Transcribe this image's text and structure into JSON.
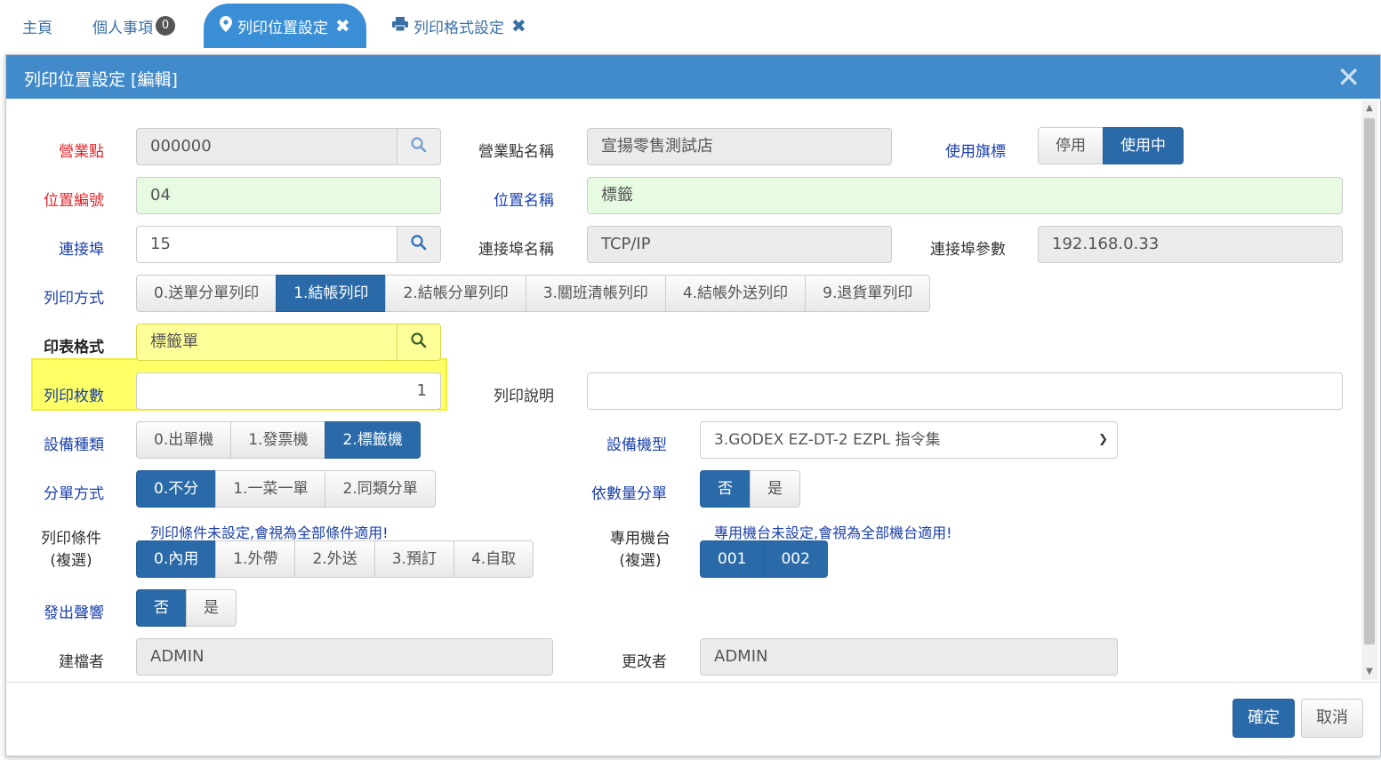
{
  "tabs": [
    {
      "label": "主頁"
    },
    {
      "label": "個人事項",
      "badge": "0"
    },
    {
      "label": "列印位置設定",
      "close": "✖"
    },
    {
      "label": "列印格式設定",
      "close": "✖"
    }
  ],
  "modal": {
    "title": "列印位置設定 [編輯]",
    "close": "✕"
  },
  "form": {
    "store": {
      "label": "營業點",
      "value": "000000"
    },
    "store_name": {
      "label": "營業點名稱",
      "value": "宣揚零售測試店"
    },
    "active_flag": {
      "label": "使用旗標",
      "options": [
        "停用",
        "使用中"
      ],
      "selected": "使用中"
    },
    "position_no": {
      "label": "位置編號",
      "value": "04"
    },
    "position_name": {
      "label": "位置名稱",
      "value": "標籤"
    },
    "port": {
      "label": "連接埠",
      "value": "15"
    },
    "port_name": {
      "label": "連接埠名稱",
      "value": "TCP/IP"
    },
    "port_param": {
      "label": "連接埠參數",
      "value": "192.168.0.33"
    },
    "print_mode": {
      "label": "列印方式",
      "options": [
        "0.送單分單列印",
        "1.結帳列印",
        "2.結帳分單列印",
        "3.關班清帳列印",
        "4.結帳外送列印",
        "9.退貨單列印"
      ],
      "selected": "1.結帳列印"
    },
    "print_format": {
      "label": "印表格式",
      "value": "標籤單"
    },
    "copies": {
      "label": "列印枚數",
      "value": "1"
    },
    "print_desc": {
      "label": "列印說明",
      "value": ""
    },
    "device_type": {
      "label": "設備種類",
      "options": [
        "0.出單機",
        "1.發票機",
        "2.標籤機"
      ],
      "selected": "2.標籤機"
    },
    "device_model": {
      "label": "設備機型",
      "value": "3.GODEX EZ-DT-2 EZPL 指令集"
    },
    "split_mode": {
      "label": "分單方式",
      "options": [
        "0.不分",
        "1.一菜一單",
        "2.同類分單"
      ],
      "selected": "0.不分"
    },
    "split_by_qty": {
      "label": "依數量分單",
      "options": [
        "否",
        "是"
      ],
      "selected": "否"
    },
    "print_condition": {
      "label1": "列印條件",
      "label2": "(複選)",
      "hint": "列印條件未設定,會視為全部條件適用!",
      "options": [
        "0.內用",
        "1.外帶",
        "2.外送",
        "3.預訂",
        "4.自取"
      ],
      "selected": [
        "0.內用"
      ]
    },
    "dedicated_machine": {
      "label1": "專用機台",
      "label2": "(複選)",
      "hint": "專用機台未設定,會視為全部機台適用!",
      "options": [
        "001",
        "002"
      ],
      "selected": [
        "001",
        "002"
      ]
    },
    "beep": {
      "label": "發出聲響",
      "options": [
        "否",
        "是"
      ],
      "selected": "否"
    },
    "creator": {
      "label": "建檔者",
      "value": "ADMIN"
    },
    "modifier": {
      "label": "更改者",
      "value": "ADMIN"
    }
  },
  "footer": {
    "confirm": "確定",
    "cancel": "取消"
  },
  "colors": {
    "header": "#428bca",
    "primary_button": "#2b6aa8",
    "highlight": "#ffff66",
    "required_label": "#e0262b",
    "label_blue": "#1a3fa8"
  }
}
